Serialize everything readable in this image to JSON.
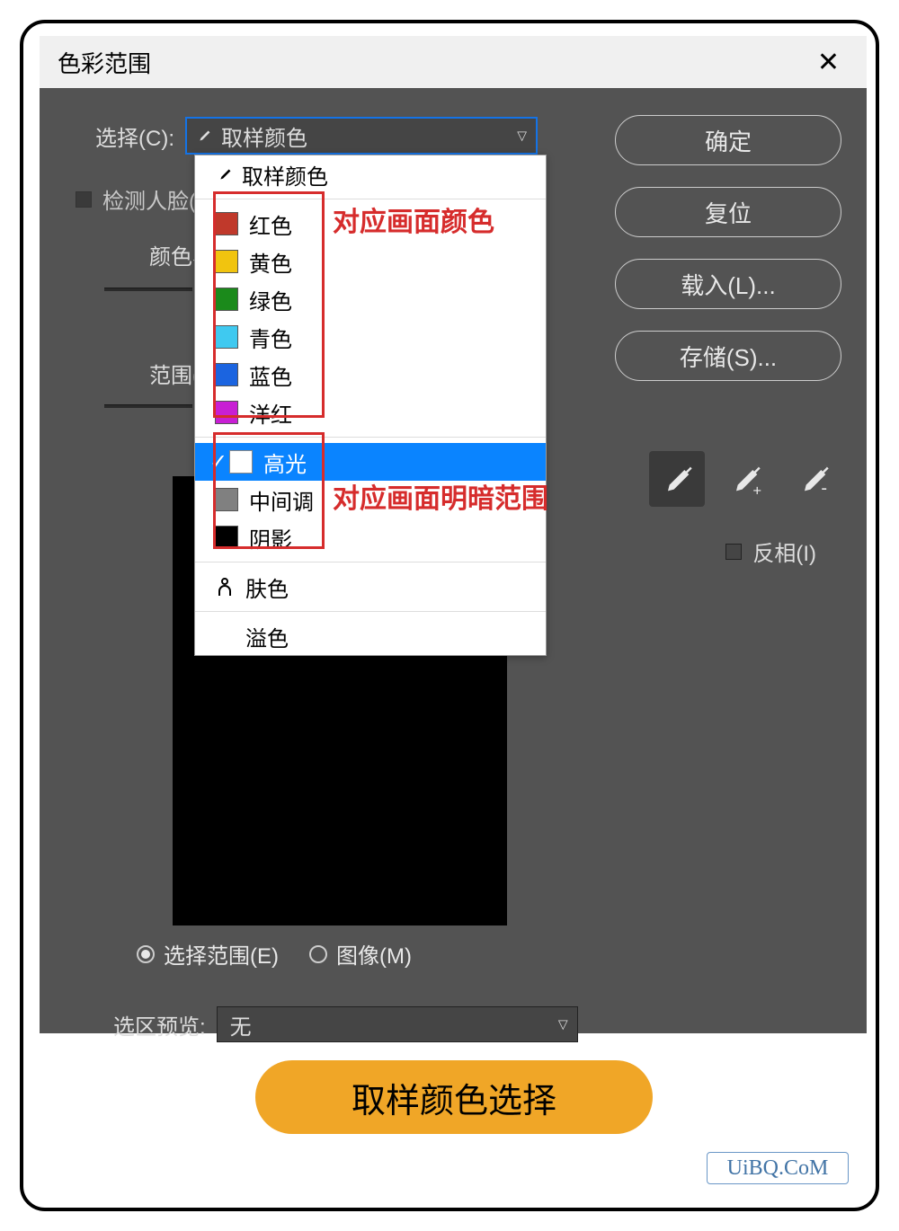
{
  "dialog": {
    "title": "色彩范围",
    "select_label": "选择(C):",
    "select_value": "取样颜色",
    "detect_faces_label": "检测人脸(",
    "fuzziness_label": "颜色容",
    "range_label": "范围(",
    "radio_selection": "选择范围(E)",
    "radio_image": "图像(M)",
    "preview_label": "选区预览:",
    "preview_value": "无",
    "invert_label": "反相(I)"
  },
  "buttons": {
    "ok": "确定",
    "reset": "复位",
    "load": "载入(L)...",
    "save": "存储(S)..."
  },
  "dropdown": {
    "sampled": "取样颜色",
    "red": "红色",
    "yellow": "黄色",
    "green": "绿色",
    "cyan": "青色",
    "blue": "蓝色",
    "magenta": "洋红",
    "highlights": "高光",
    "midtones": "中间调",
    "shadows": "阴影",
    "skin": "肤色",
    "outofgamut": "溢色"
  },
  "swatches": {
    "red": "#c0392b",
    "yellow": "#f1c40f",
    "green": "#1b8a1b",
    "cyan": "#3fc9f0",
    "blue": "#1b64e0",
    "magenta": "#c81fd4",
    "highlights": "#ffffff",
    "midtones": "#808080",
    "shadows": "#000000"
  },
  "annotations": {
    "color_group": "对应画面颜色",
    "tone_group": "对应画面明暗范围"
  },
  "caption": "取样颜色选择",
  "watermark": "UiBQ.CoM"
}
